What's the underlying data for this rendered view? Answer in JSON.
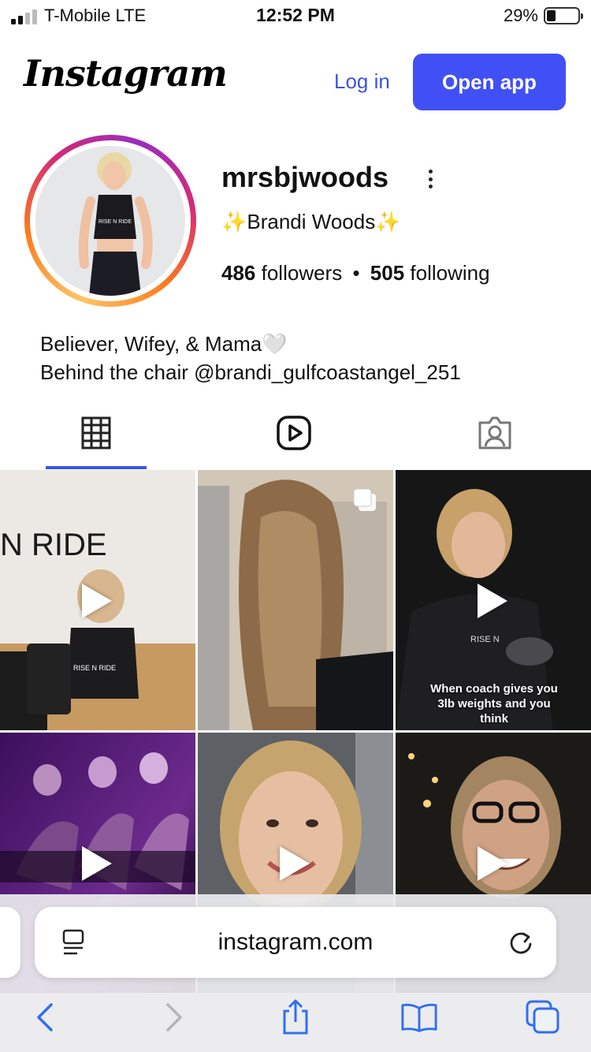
{
  "status_bar": {
    "carrier": "T-Mobile  LTE",
    "time": "12:52 PM",
    "battery_percent": "29%",
    "battery_level": 0.29
  },
  "header": {
    "logo": "Instagram",
    "login_label": "Log in",
    "open_app_label": "Open app",
    "accent_color": "#4150f5"
  },
  "profile": {
    "username": "mrsbjwoods",
    "display_name": "✨Brandi Woods✨",
    "followers_count": "486",
    "followers_label": "followers",
    "separator": "•",
    "following_count": "505",
    "following_label": "following",
    "bio_line1": "Believer, Wifey, & Mama🤍",
    "bio_line2": "Behind the chair @brandi_gulfcoastangel_251",
    "avatar_shirt_text": "RISE N RIDE"
  },
  "tabs": [
    {
      "name": "grid-icon",
      "selected": true
    },
    {
      "name": "reels-icon",
      "selected": false
    },
    {
      "name": "tagged-icon",
      "selected": false
    }
  ],
  "posts": [
    {
      "type": "video",
      "wall_text": "N RIDE",
      "shirt_text": "RISE N RIDE"
    },
    {
      "type": "carousel"
    },
    {
      "type": "video",
      "shirt_text": "RISE N",
      "caption": "When coach gives you 3lb weights and you think"
    },
    {
      "type": "video"
    },
    {
      "type": "video"
    },
    {
      "type": "video"
    }
  ],
  "browser": {
    "url": "instagram.com",
    "icons": [
      "reader-icon",
      "reload-icon",
      "back-icon",
      "forward-icon",
      "share-icon",
      "bookmarks-icon",
      "tabs-icon"
    ],
    "icon_color": "#2f6ff0"
  }
}
